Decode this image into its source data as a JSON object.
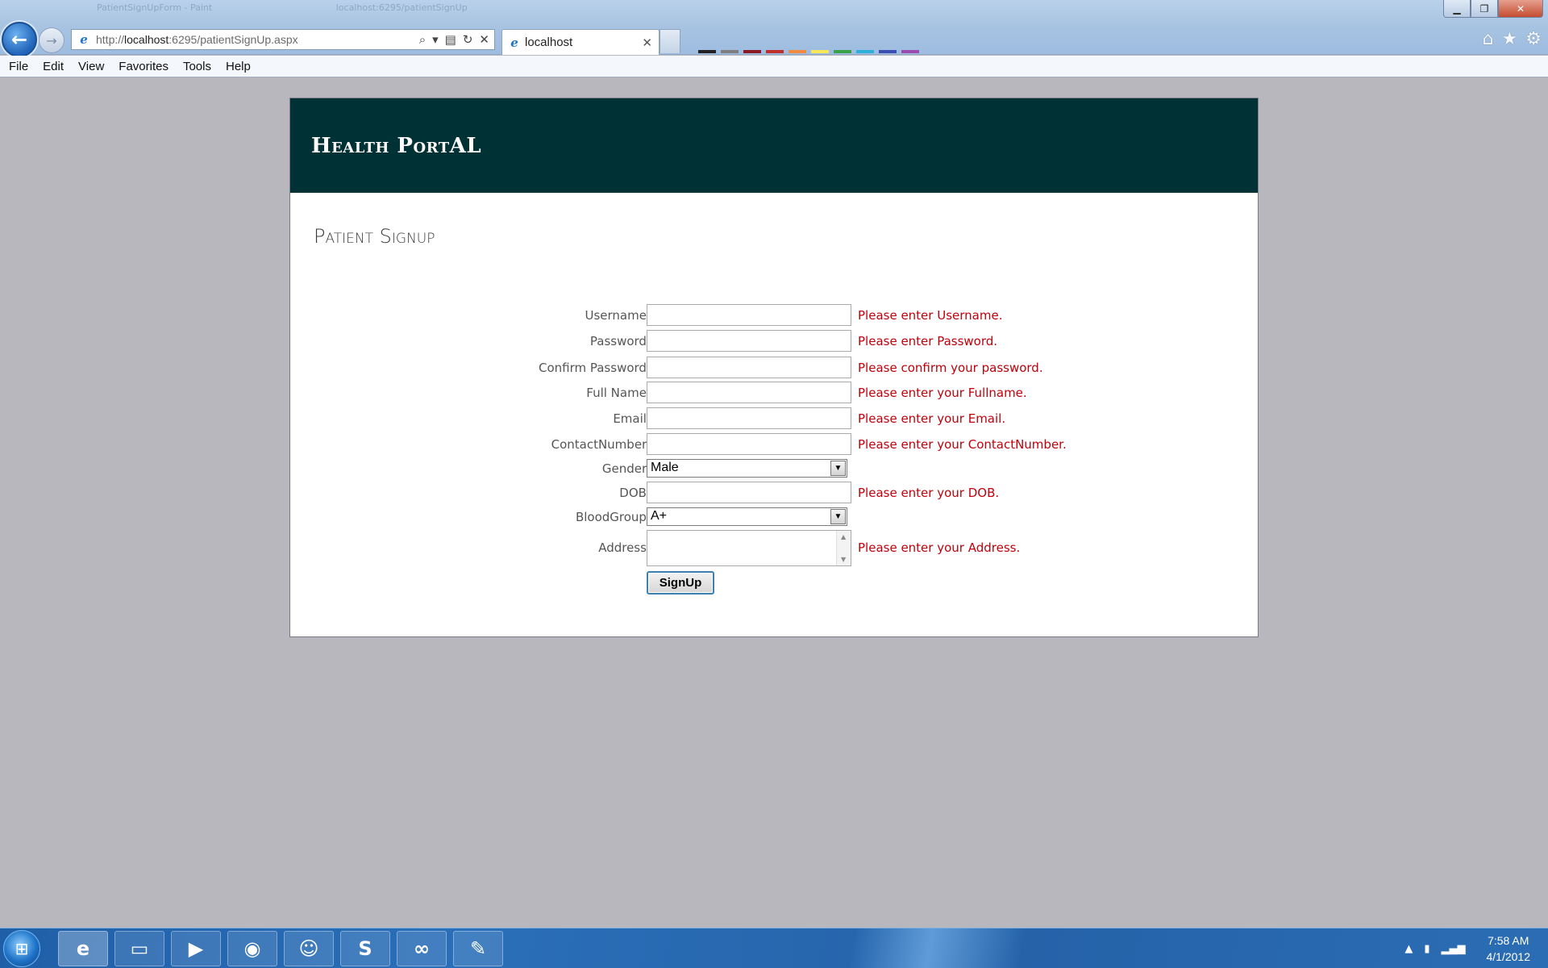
{
  "browser": {
    "ghost_tabs": [
      "PatientSignUpForm - Paint",
      "localhost:6295/patientSignUp"
    ],
    "url_prefix": "http://",
    "url_host": "localhost",
    "url_rest": ":6295/patientSignUp.aspx",
    "tab_title": "localhost",
    "menu": [
      "File",
      "Edit",
      "View",
      "Favorites",
      "Tools",
      "Help"
    ],
    "swatch_colors": [
      "#222222",
      "#7f7f7f",
      "#8a1b24",
      "#c0302c",
      "#f28b3f",
      "#f5e65a",
      "#3aa34a",
      "#2fb0d8",
      "#3b4fb2",
      "#9c4cb1"
    ]
  },
  "site": {
    "title": "Health PortAL",
    "header_color": "#003135"
  },
  "page": {
    "heading": "Patient Signup"
  },
  "form": {
    "username": {
      "label": "Username:",
      "value": "",
      "error": "Please enter Username."
    },
    "password": {
      "label": "Password:",
      "value": "",
      "error": "Please enter Password."
    },
    "confirm_password": {
      "label": "Confirm Password:",
      "value": "",
      "error": "Please confirm your password."
    },
    "full_name": {
      "label": "Full Name:",
      "value": "",
      "error": "Please enter your Fullname."
    },
    "email": {
      "label": "Email:",
      "value": "",
      "error": "Please enter your Email."
    },
    "contact_number": {
      "label": "ContactNumber:",
      "value": "",
      "error": "Please enter your ContactNumber."
    },
    "gender": {
      "label": "Gender:",
      "selected": "Male"
    },
    "dob": {
      "label": "DOB:",
      "value": "",
      "error": "Please enter your DOB."
    },
    "blood_group": {
      "label": "BloodGroup:",
      "selected": "A+"
    },
    "address": {
      "label": "Address:",
      "value": "",
      "error": "Please enter your Address."
    },
    "submit_label": "SignUp",
    "error_color": "#c0000a"
  },
  "taskbar": {
    "start_icon": "windows-orb-icon",
    "apps": [
      "internet-explorer-icon",
      "file-explorer-icon",
      "media-player-icon",
      "chrome-icon",
      "messenger-icon",
      "skype-icon",
      "visual-studio-icon",
      "paint-icon"
    ],
    "time": "7:58 AM",
    "date": "4/1/2012"
  }
}
